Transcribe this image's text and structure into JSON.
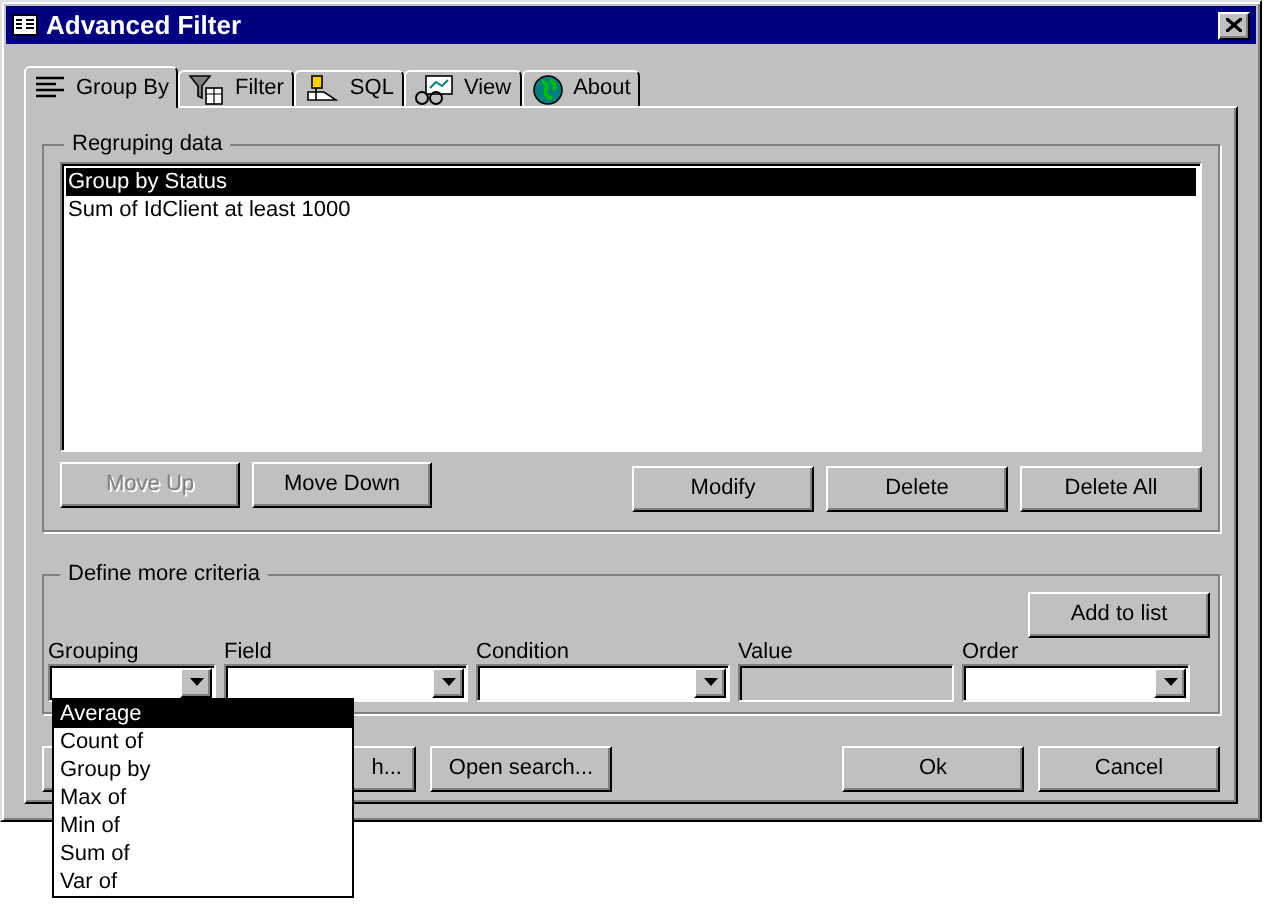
{
  "window": {
    "title": "Advanced Filter"
  },
  "tabs": [
    {
      "label": "Group By",
      "selected": true
    },
    {
      "label": "Filter",
      "selected": false
    },
    {
      "label": "SQL",
      "selected": false
    },
    {
      "label": "View",
      "selected": false
    },
    {
      "label": "About",
      "selected": false
    }
  ],
  "regrouping": {
    "title": "Regruping data",
    "rows": [
      {
        "text": "Group by Status",
        "selected": true
      },
      {
        "text": "Sum of IdClient at least 1000",
        "selected": false
      }
    ],
    "left_buttons": [
      {
        "label": "Move Up",
        "disabled": true
      },
      {
        "label": "Move Down",
        "disabled": false
      }
    ],
    "right_buttons": [
      {
        "label": "Modify",
        "disabled": false
      },
      {
        "label": "Delete",
        "disabled": false
      },
      {
        "label": "Delete All",
        "disabled": false
      }
    ]
  },
  "criteria": {
    "title": "Define more criteria",
    "add_button": "Add to list",
    "fields": [
      {
        "label": "Grouping",
        "kind": "combo",
        "disabled": false
      },
      {
        "label": "Field",
        "kind": "combo",
        "disabled": false
      },
      {
        "label": "Condition",
        "kind": "combo",
        "disabled": false
      },
      {
        "label": "Value",
        "kind": "text",
        "disabled": true
      },
      {
        "label": "Order",
        "kind": "combo",
        "disabled": false
      }
    ]
  },
  "dropdown": {
    "options": [
      {
        "label": "Average",
        "selected": true
      },
      {
        "label": "Count of",
        "selected": false
      },
      {
        "label": "Group by",
        "selected": false
      },
      {
        "label": "Max of",
        "selected": false
      },
      {
        "label": "Min of",
        "selected": false
      },
      {
        "label": "Sum of",
        "selected": false
      },
      {
        "label": "Var of",
        "selected": false
      }
    ]
  },
  "footer_buttons_left": [
    "h...",
    "Open search..."
  ],
  "footer_buttons_right": [
    "Ok",
    "Cancel"
  ]
}
